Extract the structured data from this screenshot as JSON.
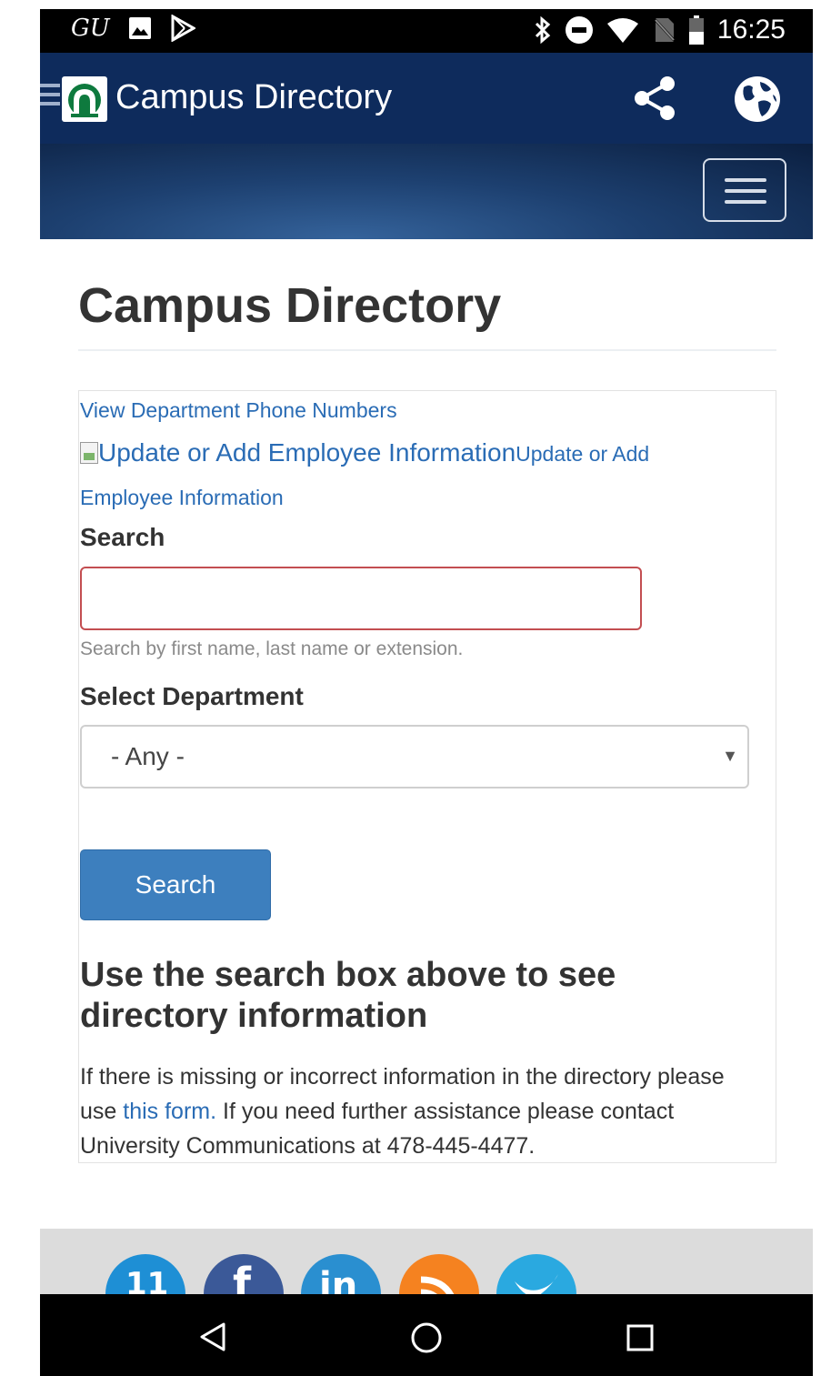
{
  "status_bar": {
    "carrier": "GU",
    "time": "16:25",
    "left_icons": [
      "image-icon",
      "play-store-icon"
    ],
    "right_icons": [
      "bluetooth-icon",
      "do-not-disturb-icon",
      "wifi-icon",
      "no-sim-icon",
      "battery-icon"
    ]
  },
  "app_bar": {
    "title": "Campus Directory",
    "background": "#0e2b5c"
  },
  "page": {
    "title": "Campus Directory",
    "links": {
      "department_phone": "View Department Phone Numbers",
      "update_img_alt": "Update or Add Employee Information",
      "update_text": "Update or Add Employee Information"
    },
    "search": {
      "label": "Search",
      "value": "",
      "help": "Search by first name, last name or extension."
    },
    "department": {
      "label": "Select Department",
      "selected": "- Any -"
    },
    "search_button": "Search",
    "result_heading": "Use the search box above to see directory information",
    "info": {
      "before": "If there is missing or incorrect information in the directory please use ",
      "link": "this form.",
      "after": " If you need further assistance please contact University Communications at 478-445-4477."
    }
  },
  "footer": {
    "social_icons": [
      {
        "name": "youtube-icon",
        "color": "#1e8fd5"
      },
      {
        "name": "facebook-icon",
        "color": "#3b5998"
      },
      {
        "name": "linkedin-icon",
        "color": "#2a8fd0"
      },
      {
        "name": "rss-icon",
        "color": "#f58220"
      },
      {
        "name": "twitter-icon",
        "color": "#2aa9e0"
      }
    ]
  },
  "colors": {
    "link": "#2a6cb5",
    "primary_button": "#3d7fbe",
    "error_border": "#c34e51"
  }
}
